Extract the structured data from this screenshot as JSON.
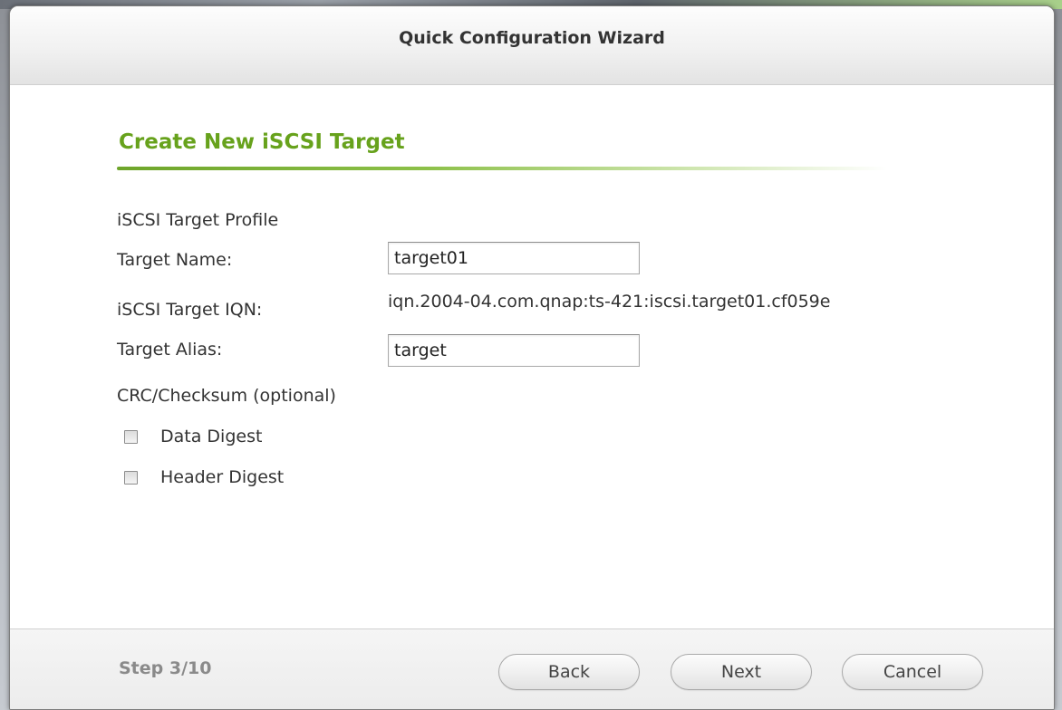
{
  "dialog": {
    "title": "Quick Configuration Wizard"
  },
  "section": {
    "title": "Create New iSCSI Target"
  },
  "form": {
    "profile_heading": "iSCSI Target Profile",
    "target_name_label": "Target Name:",
    "target_name_value": "target01",
    "iqn_label": "iSCSI Target IQN:",
    "iqn_value": "iqn.2004-04.com.qnap:ts-421:iscsi.target01.cf059e",
    "target_alias_label": "Target Alias:",
    "target_alias_value": "target",
    "checksum_heading": "CRC/Checksum (optional)",
    "data_digest_label": "Data Digest",
    "data_digest_checked": false,
    "header_digest_label": "Header Digest",
    "header_digest_checked": false
  },
  "footer": {
    "step_text": "Step 3/10",
    "back_label": "Back",
    "next_label": "Next",
    "cancel_label": "Cancel"
  },
  "colors": {
    "accent_green": "#67a21c",
    "text": "#333333",
    "step_text": "#8a8a8a"
  }
}
